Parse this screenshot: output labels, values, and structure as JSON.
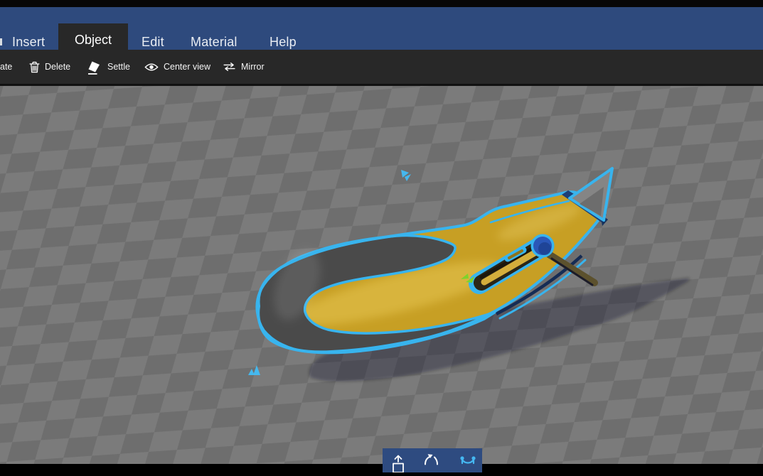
{
  "menubar": {
    "background": "#2e4a7d",
    "active_tab_background": "#282828",
    "tabs": [
      {
        "label": "Insert",
        "active": false
      },
      {
        "label": "Object",
        "active": true
      },
      {
        "label": "Edit",
        "active": false
      },
      {
        "label": "Material",
        "active": false
      },
      {
        "label": "Help",
        "active": false
      }
    ]
  },
  "toolbar": {
    "background": "#282828",
    "clipped_label": "ate",
    "items": [
      {
        "label": "Delete",
        "icon": "trash-icon"
      },
      {
        "label": "Settle",
        "icon": "settle-icon"
      },
      {
        "label": "Center view",
        "icon": "eye-icon"
      },
      {
        "label": "Mirror",
        "icon": "mirror-arrows-icon"
      }
    ]
  },
  "viewport": {
    "floor_light": "#7b7b7b",
    "floor_dark": "#6e6e6e",
    "shadow_color": "rgba(18,18,22,0.30)",
    "selection_outline": "#38b4ee",
    "model": {
      "name": "utility knife",
      "body_color": "#c79f24",
      "grip_color": "#4a4a4a",
      "blade_color": "#858585",
      "blade_shade_color": "#6d6d6d",
      "channel_color": "#1d3f76",
      "button_color": "#2a57b8",
      "slot_dark_color": "#2c2616",
      "slot_ridge_color": "#d4ae3c",
      "olive_band_color": "#5c512d"
    },
    "markers": {
      "cyan_marker_color": "#45b8ee",
      "green_marker_color": "#7ed32b"
    }
  },
  "gizmo_bar": {
    "background": "#2e4b80",
    "inactive_icon_color": "#ffffff",
    "active_icon_color": "#45b8f2",
    "buttons": [
      {
        "name": "move",
        "icon": "move-icon",
        "active": false
      },
      {
        "name": "rotate",
        "icon": "rotate-icon",
        "active": false
      },
      {
        "name": "scale",
        "icon": "scale-icon",
        "active": true
      }
    ]
  }
}
